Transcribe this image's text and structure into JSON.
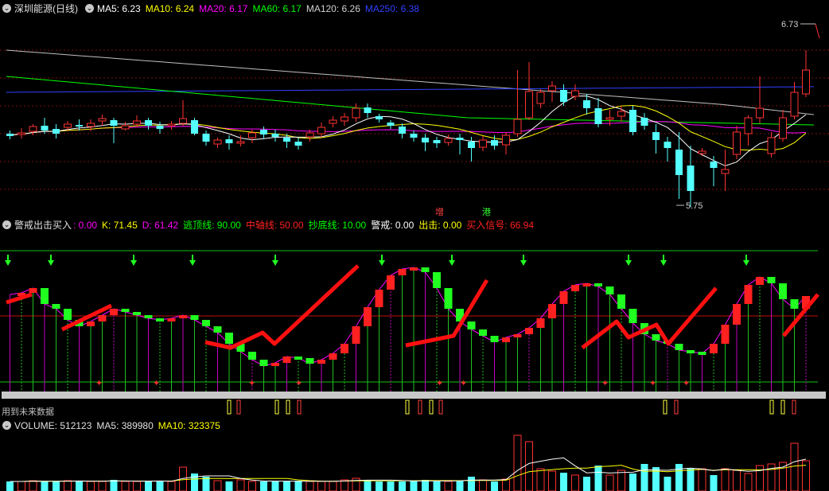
{
  "main_header": {
    "title": "深圳能源(日线)",
    "ma5": "MA5: 6.23",
    "ma10": "MA10: 6.24",
    "ma20": "MA20: 6.17",
    "ma60": "MA60: 6.17",
    "ma120": "MA120: 6.26",
    "ma250": "MA250: 6.38",
    "high_label": "6.73",
    "low_label": "5.75",
    "mark_zeng": "增",
    "mark_gang": "港"
  },
  "indicator_header": {
    "name": "警戒出击买入",
    "v0": ": 0.00",
    "k": "K: 71.45",
    "d": "D: 61.42",
    "escape_line": "逃顶线: 90.00",
    "mid_line": "中轴线: 50.00",
    "bottom_line": "抄底线: 10.00",
    "alert": "警戒: 0.00",
    "attack": "出击: 0.00",
    "buy_signal": "买入信号: 66.94",
    "future_note": "用到未来数据"
  },
  "volume_header": {
    "volume": "VOLUME: 512123",
    "ma5": "MA5: 389980",
    "ma10": "MA10: 323375"
  },
  "colors": {
    "up": "#ff3232",
    "down": "#54ffff",
    "ma5": "#ffffff",
    "ma10": "#ffff00",
    "ma20": "#ff00ff",
    "ma60": "#00ff00",
    "ma120": "#c0c0c0",
    "ma250": "#3040ff",
    "kdj_up": "#ff2020",
    "kdj_down": "#20ff20"
  }
}
